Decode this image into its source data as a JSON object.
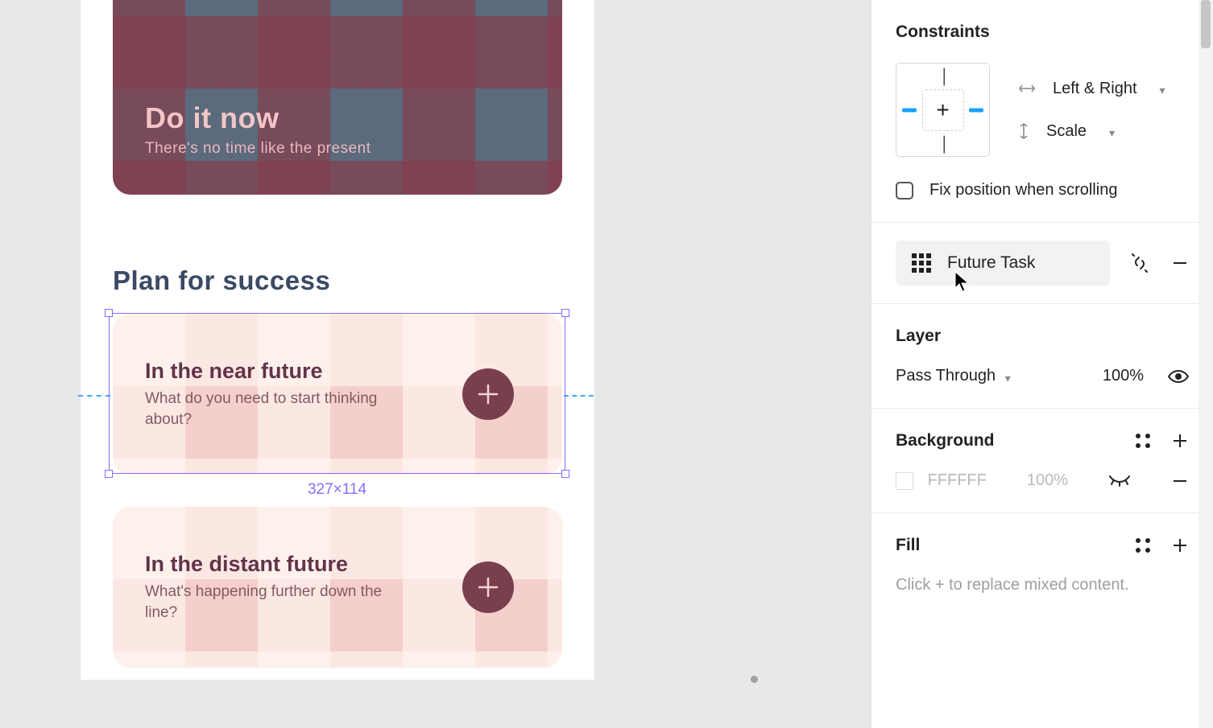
{
  "canvas": {
    "dark_card": {
      "title": "Do it now",
      "subtitle": "There's no time like the present"
    },
    "section_heading": "Plan for success",
    "pink_cards": [
      {
        "title": "In the near future",
        "subtitle": "What do you need to start thinking about?"
      },
      {
        "title": "In the distant future",
        "subtitle": "What's happening further down the line?"
      }
    ],
    "selection_dims": "327×114"
  },
  "panel": {
    "constraints": {
      "heading": "Constraints",
      "horizontal": "Left & Right",
      "vertical": "Scale",
      "fix_label": "Fix position when scrolling"
    },
    "component": {
      "name": "Future Task"
    },
    "layer": {
      "heading": "Layer",
      "blend": "Pass Through",
      "opacity": "100%"
    },
    "background": {
      "heading": "Background",
      "hex": "FFFFFF",
      "opacity": "100%"
    },
    "fill": {
      "heading": "Fill",
      "hint": "Click + to replace mixed content."
    }
  }
}
